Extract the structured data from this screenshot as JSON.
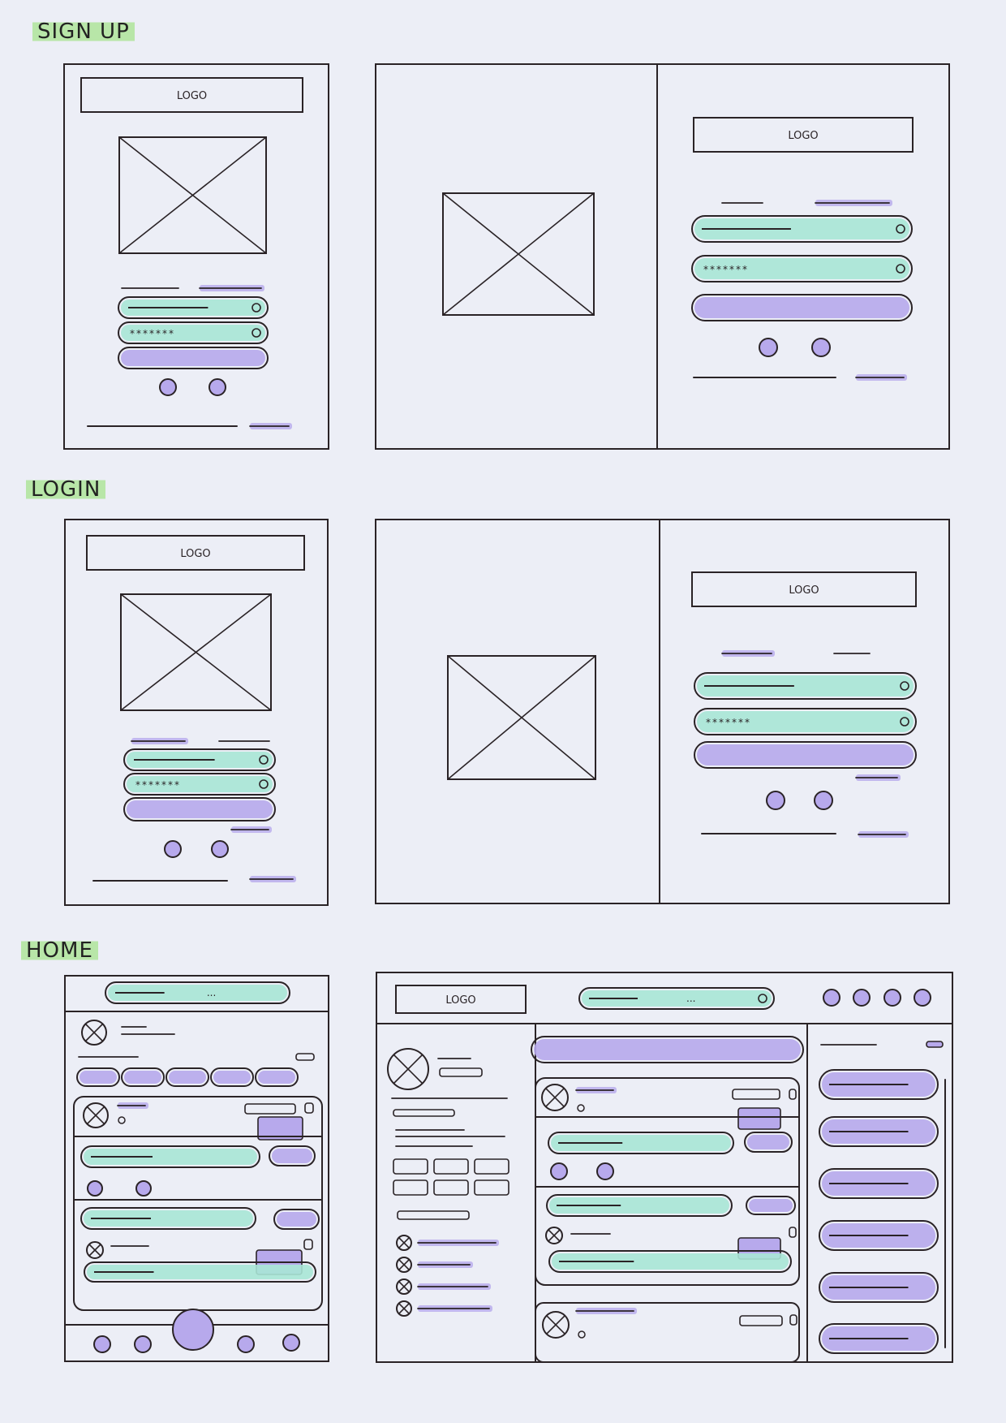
{
  "sections": {
    "signup": {
      "label": "SIGN UP"
    },
    "login": {
      "label": "LOGIN"
    },
    "home": {
      "label": "HOME"
    }
  },
  "logo_text": "LOGO",
  "password_mask": "*******",
  "search_dots": "...",
  "colors": {
    "paper": "#eceef6",
    "ink": "#2a2326",
    "mint": "#a9e6d6",
    "lavender": "#b7a9ec",
    "label_highlight": "#b8e6a8"
  }
}
